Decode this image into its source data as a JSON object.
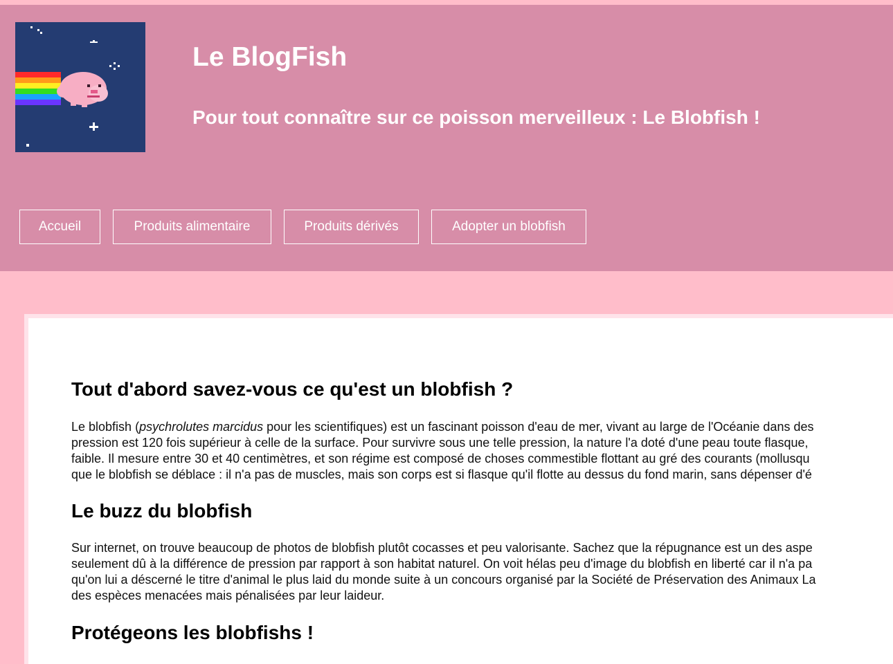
{
  "header": {
    "title": "Le BlogFish",
    "tagline": "Pour tout connaître sur ce poisson merveilleux : Le Blobfish !",
    "logo_icon": "nyan-blobfish-logo",
    "background_color": "#d78da8"
  },
  "nav": {
    "items": [
      {
        "label": "Accueil"
      },
      {
        "label": "Produits alimentaire"
      },
      {
        "label": "Produits dérivés"
      },
      {
        "label": "Adopter un blobfish"
      }
    ]
  },
  "main": {
    "sections": [
      {
        "title": "Tout d'abord savez-vous ce qu'est un blobfish ?",
        "para": {
          "l1_a": "Le blobfish (",
          "l1_em": "psychrolutes marcidus",
          "l1_b": " pour les scientifiques) est un fascinant poisson d'eau de mer, vivant au large de l'Océanie dans des",
          "l2": "pression est 120 fois supérieur à celle de la surface. Pour survivre sous une telle pression, la nature l'a doté d'une peau toute flasque,",
          "l3": "faible. Il mesure entre 30 et 40 centimètres, et son régime est composé de choses commestible flottant au gré des courants (mollusqu",
          "l4": "que le blobfish se déblace : il n'a pas de muscles, mais son corps est si flasque qu'il flotte au dessus du fond marin, sans dépenser d'é"
        }
      },
      {
        "title": "Le buzz du blobfish",
        "para": {
          "l1": "Sur internet, on trouve beaucoup de photos de blobfish plutôt cocasses et peu valorisante. Sachez que la répugnance est un des aspe",
          "l2": "seulement dû à la différence de pression par rapport à son habitat naturel. On voit hélas peu d'image du blobfish en liberté car il n'a pa",
          "l3": "qu'on lui a déscerné le titre d'animal le plus laid du monde suite à un concours organisé par la Société de Préservation des Animaux La",
          "l4": "des espèces menacées mais pénalisées par leur laideur."
        }
      },
      {
        "title": "Protégeons les blobfishs !"
      }
    ]
  }
}
